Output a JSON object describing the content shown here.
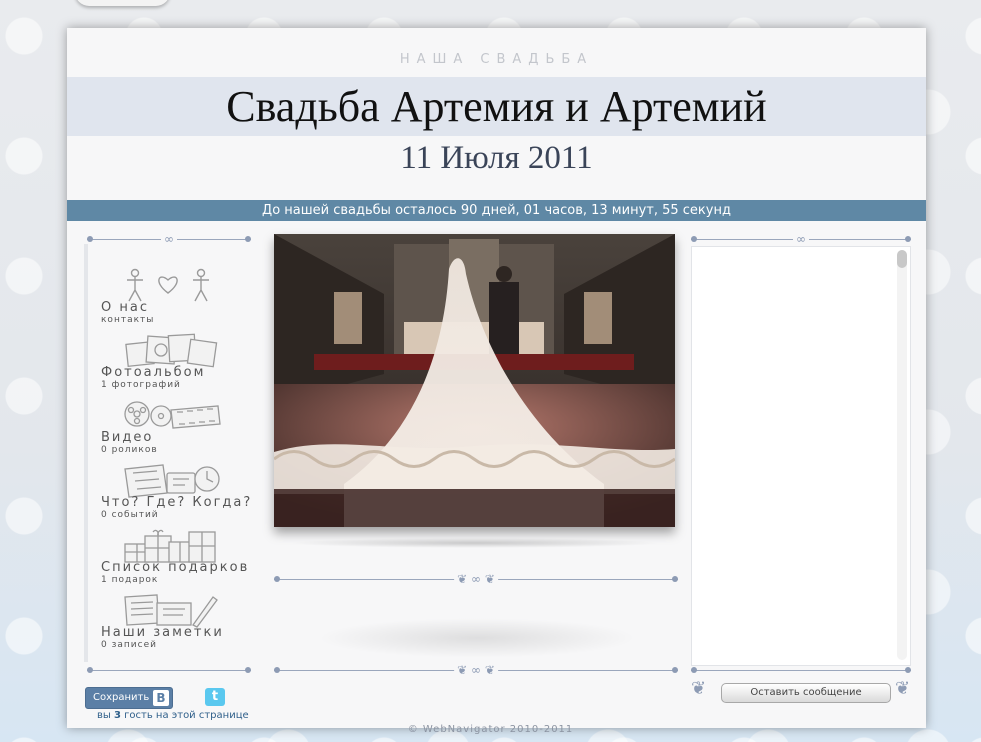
{
  "header": {
    "kicker": "НАША СВАДЬБА",
    "title": "Свадьба Артемия и Артемий",
    "date": "11 Июля 2011"
  },
  "countdown": "До нашей свадьбы осталось 90 дней, 01 часов, 13 минут, 55 секунд",
  "nav": {
    "items": [
      {
        "label": "О нас",
        "sub": "контакты",
        "icon": "people-heart-icon"
      },
      {
        "label": "Фотоальбом",
        "sub": "1 фотографий",
        "icon": "photos-icon"
      },
      {
        "label": "Видео",
        "sub": "0 роликов",
        "icon": "film-reel-icon"
      },
      {
        "label": "Что? Где? Когда?",
        "sub": "0 событий",
        "icon": "map-clock-icon"
      },
      {
        "label": "Список подарков",
        "sub": "1 подарок",
        "icon": "gifts-icon"
      },
      {
        "label": "Наши заметки",
        "sub": "0 записей",
        "icon": "notes-icon"
      }
    ]
  },
  "guestbook": {
    "leave_message": "Оставить сообщение"
  },
  "footer": {
    "save_label": "Сохранить",
    "vk_badge": "B",
    "twitter_glyph": "t",
    "visitors_prefix": "вы",
    "visitors_count": "3",
    "visitors_suffix": "гость на этой странице",
    "copyright": "© WebNavigator 2010-2011"
  },
  "colors": {
    "countdown_bar": "#5f88a5",
    "title_band": "#e0e5ee",
    "accent": "#5b7fa6"
  }
}
